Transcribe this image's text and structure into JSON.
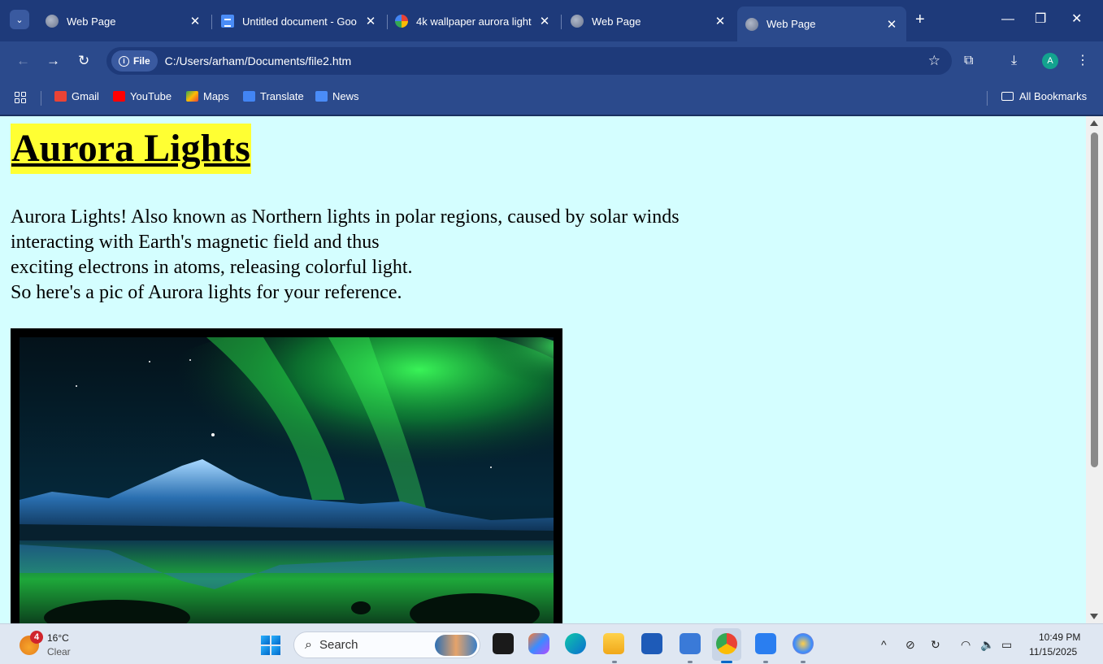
{
  "browser": {
    "tabs": [
      {
        "label": "Web Page",
        "icon": "globe-icon",
        "active": false
      },
      {
        "label": "Untitled document - Goo",
        "icon": "docs-icon",
        "active": false
      },
      {
        "label": "4k wallpaper aurora light",
        "icon": "google-icon",
        "active": false
      },
      {
        "label": "Web Page",
        "icon": "globe-icon",
        "active": false
      },
      {
        "label": "Web Page",
        "icon": "globe-icon",
        "active": true
      }
    ],
    "address": {
      "chip_label": "File",
      "url": "C:/Users/arham/Documents/file2.htm"
    },
    "profile_initial": "A",
    "bookmarks": [
      {
        "label": "Gmail",
        "color": "#ea4335"
      },
      {
        "label": "YouTube",
        "color": "#ff0000"
      },
      {
        "label": "Maps",
        "color": "#34a853"
      },
      {
        "label": "Translate",
        "color": "#4285f4"
      },
      {
        "label": "News",
        "color": "#4a8cf7"
      }
    ],
    "all_bookmarks": "All Bookmarks"
  },
  "page": {
    "heading": "Aurora Lights",
    "paragraph_lines": [
      "Aurora Lights! Also known as Northern lights in polar regions, caused by solar winds",
      "interacting with Earth's magnetic field and thus",
      "exciting electrons in atoms, releasing colorful light.",
      "So here's a pic of Aurora lights for your reference."
    ],
    "heading_bg": "#ffff33",
    "page_bg": "#d4feff"
  },
  "taskbar": {
    "weather": {
      "badge": "4",
      "temp": "16°C",
      "condition": "Clear"
    },
    "search_placeholder": "Search",
    "clock": {
      "time": "10:49 PM",
      "date": "11/15/2025"
    }
  }
}
